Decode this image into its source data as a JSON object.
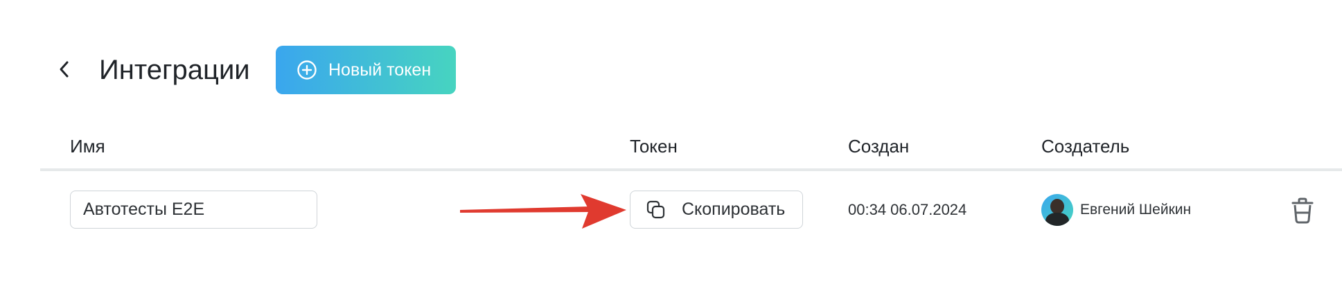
{
  "header": {
    "title": "Интеграции",
    "new_token_label": "Новый токен",
    "back_icon": "chevron-left-icon",
    "new_token_icon": "plus-circle-icon"
  },
  "table": {
    "columns": [
      "Имя",
      "Токен",
      "Создан",
      "Создатель"
    ],
    "rows": [
      {
        "name": "Автотесты E2E",
        "token_action_label": "Скопировать",
        "created": "00:34 06.07.2024",
        "creator": "Евгений Шейкин"
      }
    ]
  },
  "colors": {
    "accent_gradient_start": "#3aa6ee",
    "accent_gradient_end": "#47d4c0",
    "annotation_arrow": "#e03a2f"
  }
}
